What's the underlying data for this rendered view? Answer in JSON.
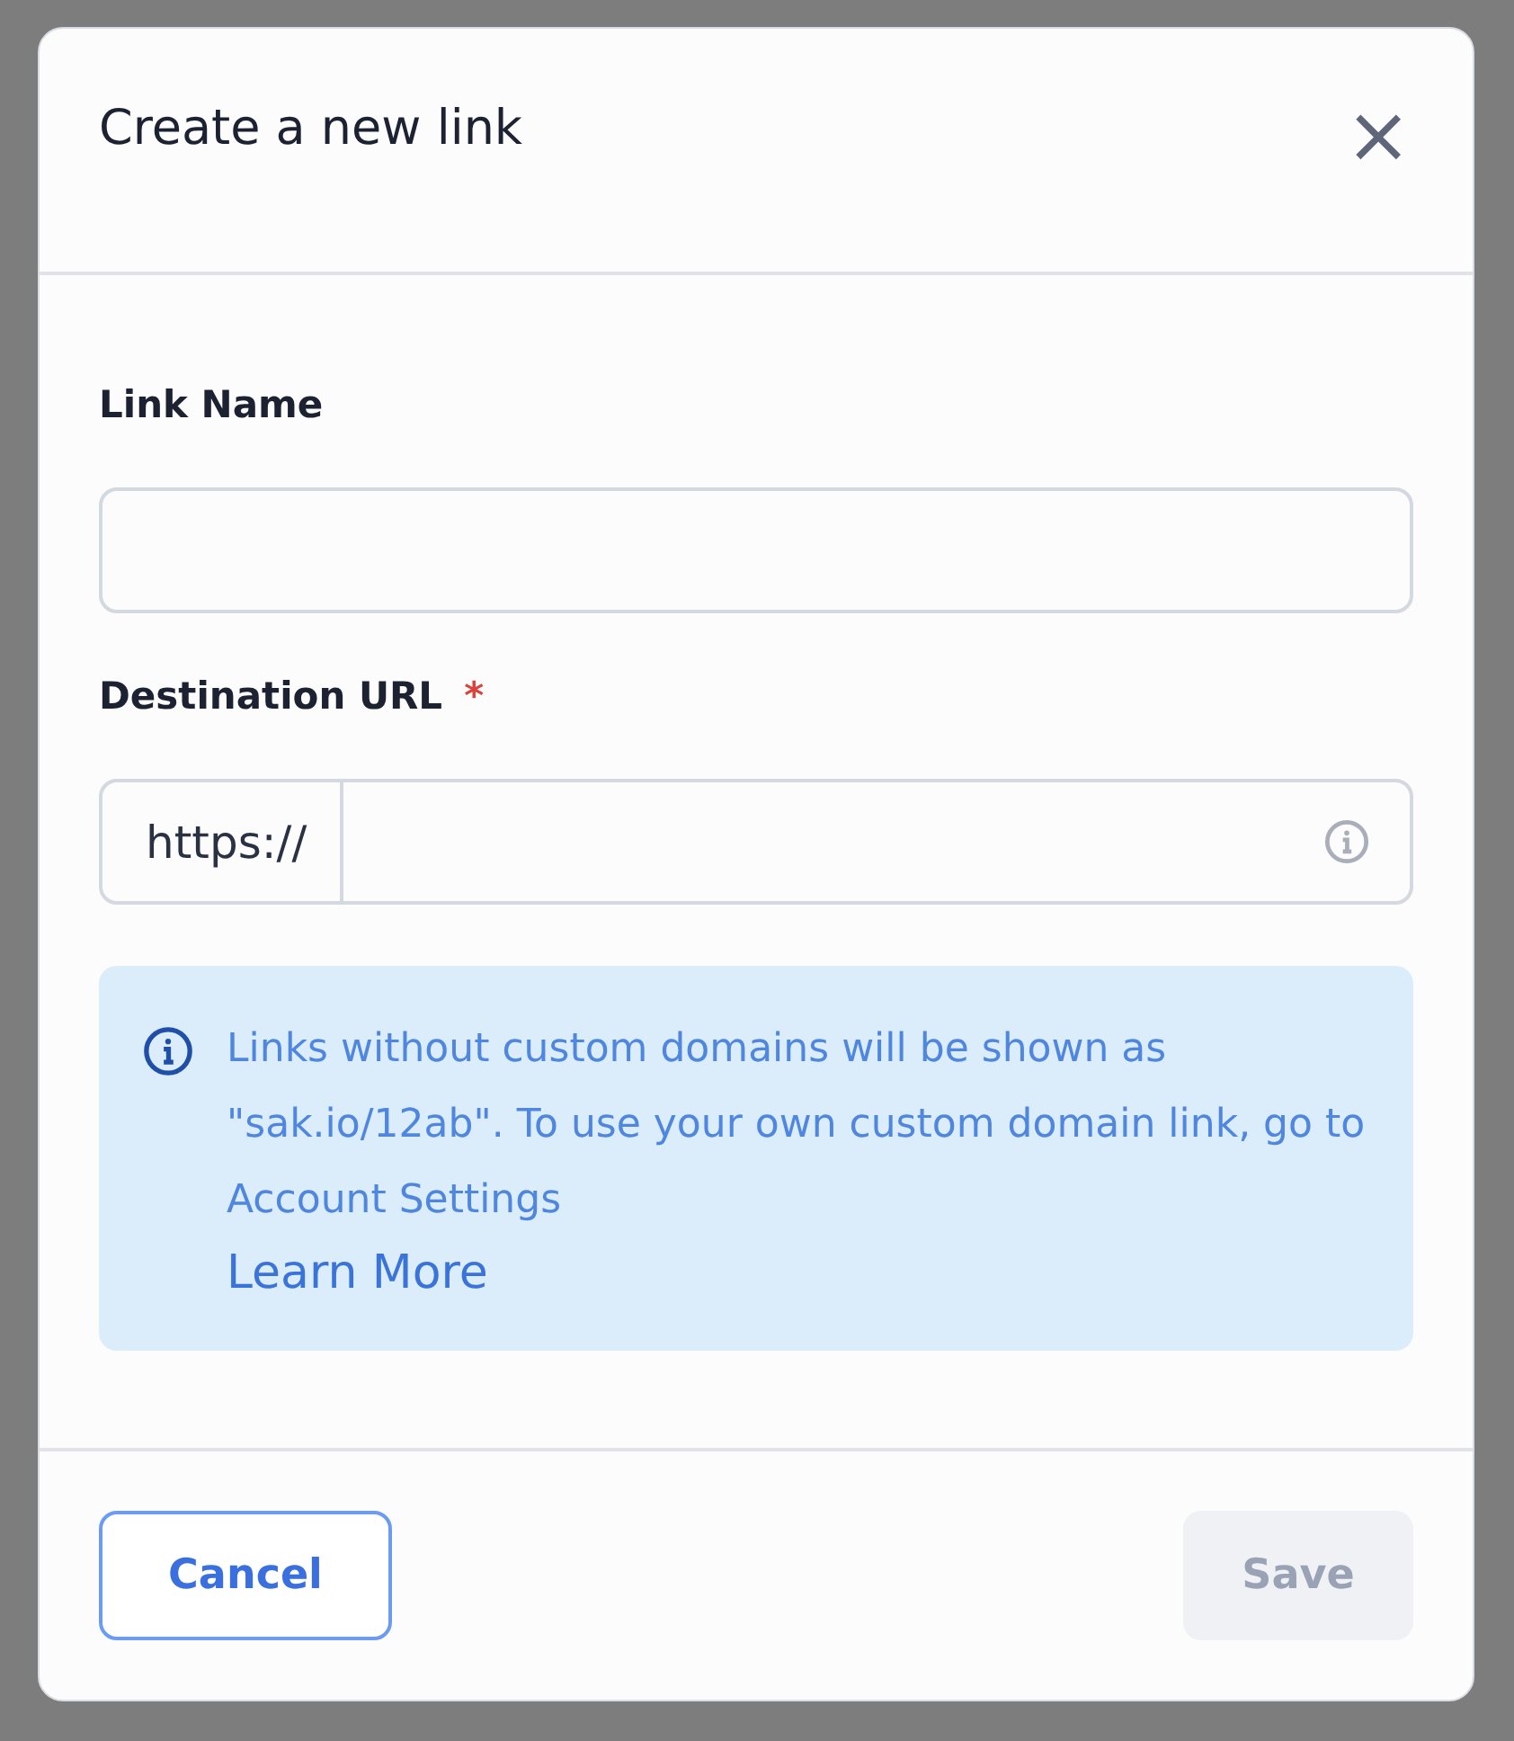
{
  "dialog": {
    "title": "Create a new link",
    "close": "×"
  },
  "fields": [
    {
      "label": "Link Name",
      "kind": "plain"
    },
    {
      "label": "Destination URL",
      "required_mark": "*",
      "kind": "prefixed",
      "prefix": "https://"
    }
  ],
  "notice": {
    "text": "Links without custom domains will be shown as \"sak.io/12ab\". To use your own custom domain link, go to Account Settings",
    "link": "Learn More"
  },
  "buttons": [
    {
      "label": "Cancel",
      "kind": "secondary"
    },
    {
      "label": "Save",
      "kind": "primary",
      "disabled": true
    }
  ]
}
